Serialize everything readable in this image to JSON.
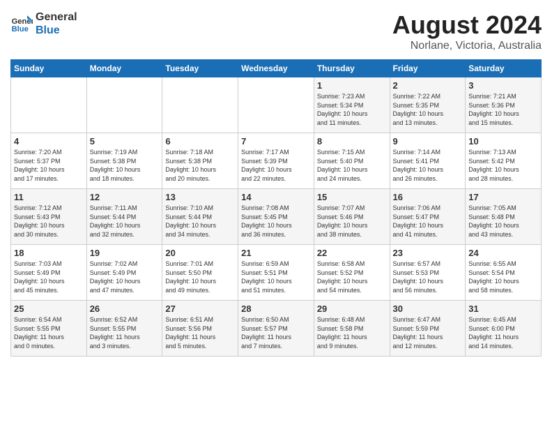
{
  "logo": {
    "line1": "General",
    "line2": "Blue"
  },
  "title": "August 2024",
  "subtitle": "Norlane, Victoria, Australia",
  "days_of_week": [
    "Sunday",
    "Monday",
    "Tuesday",
    "Wednesday",
    "Thursday",
    "Friday",
    "Saturday"
  ],
  "weeks": [
    [
      {
        "day": "",
        "info": ""
      },
      {
        "day": "",
        "info": ""
      },
      {
        "day": "",
        "info": ""
      },
      {
        "day": "",
        "info": ""
      },
      {
        "day": "1",
        "info": "Sunrise: 7:23 AM\nSunset: 5:34 PM\nDaylight: 10 hours\nand 11 minutes."
      },
      {
        "day": "2",
        "info": "Sunrise: 7:22 AM\nSunset: 5:35 PM\nDaylight: 10 hours\nand 13 minutes."
      },
      {
        "day": "3",
        "info": "Sunrise: 7:21 AM\nSunset: 5:36 PM\nDaylight: 10 hours\nand 15 minutes."
      }
    ],
    [
      {
        "day": "4",
        "info": "Sunrise: 7:20 AM\nSunset: 5:37 PM\nDaylight: 10 hours\nand 17 minutes."
      },
      {
        "day": "5",
        "info": "Sunrise: 7:19 AM\nSunset: 5:38 PM\nDaylight: 10 hours\nand 18 minutes."
      },
      {
        "day": "6",
        "info": "Sunrise: 7:18 AM\nSunset: 5:38 PM\nDaylight: 10 hours\nand 20 minutes."
      },
      {
        "day": "7",
        "info": "Sunrise: 7:17 AM\nSunset: 5:39 PM\nDaylight: 10 hours\nand 22 minutes."
      },
      {
        "day": "8",
        "info": "Sunrise: 7:15 AM\nSunset: 5:40 PM\nDaylight: 10 hours\nand 24 minutes."
      },
      {
        "day": "9",
        "info": "Sunrise: 7:14 AM\nSunset: 5:41 PM\nDaylight: 10 hours\nand 26 minutes."
      },
      {
        "day": "10",
        "info": "Sunrise: 7:13 AM\nSunset: 5:42 PM\nDaylight: 10 hours\nand 28 minutes."
      }
    ],
    [
      {
        "day": "11",
        "info": "Sunrise: 7:12 AM\nSunset: 5:43 PM\nDaylight: 10 hours\nand 30 minutes."
      },
      {
        "day": "12",
        "info": "Sunrise: 7:11 AM\nSunset: 5:44 PM\nDaylight: 10 hours\nand 32 minutes."
      },
      {
        "day": "13",
        "info": "Sunrise: 7:10 AM\nSunset: 5:44 PM\nDaylight: 10 hours\nand 34 minutes."
      },
      {
        "day": "14",
        "info": "Sunrise: 7:08 AM\nSunset: 5:45 PM\nDaylight: 10 hours\nand 36 minutes."
      },
      {
        "day": "15",
        "info": "Sunrise: 7:07 AM\nSunset: 5:46 PM\nDaylight: 10 hours\nand 38 minutes."
      },
      {
        "day": "16",
        "info": "Sunrise: 7:06 AM\nSunset: 5:47 PM\nDaylight: 10 hours\nand 41 minutes."
      },
      {
        "day": "17",
        "info": "Sunrise: 7:05 AM\nSunset: 5:48 PM\nDaylight: 10 hours\nand 43 minutes."
      }
    ],
    [
      {
        "day": "18",
        "info": "Sunrise: 7:03 AM\nSunset: 5:49 PM\nDaylight: 10 hours\nand 45 minutes."
      },
      {
        "day": "19",
        "info": "Sunrise: 7:02 AM\nSunset: 5:49 PM\nDaylight: 10 hours\nand 47 minutes."
      },
      {
        "day": "20",
        "info": "Sunrise: 7:01 AM\nSunset: 5:50 PM\nDaylight: 10 hours\nand 49 minutes."
      },
      {
        "day": "21",
        "info": "Sunrise: 6:59 AM\nSunset: 5:51 PM\nDaylight: 10 hours\nand 51 minutes."
      },
      {
        "day": "22",
        "info": "Sunrise: 6:58 AM\nSunset: 5:52 PM\nDaylight: 10 hours\nand 54 minutes."
      },
      {
        "day": "23",
        "info": "Sunrise: 6:57 AM\nSunset: 5:53 PM\nDaylight: 10 hours\nand 56 minutes."
      },
      {
        "day": "24",
        "info": "Sunrise: 6:55 AM\nSunset: 5:54 PM\nDaylight: 10 hours\nand 58 minutes."
      }
    ],
    [
      {
        "day": "25",
        "info": "Sunrise: 6:54 AM\nSunset: 5:55 PM\nDaylight: 11 hours\nand 0 minutes."
      },
      {
        "day": "26",
        "info": "Sunrise: 6:52 AM\nSunset: 5:55 PM\nDaylight: 11 hours\nand 3 minutes."
      },
      {
        "day": "27",
        "info": "Sunrise: 6:51 AM\nSunset: 5:56 PM\nDaylight: 11 hours\nand 5 minutes."
      },
      {
        "day": "28",
        "info": "Sunrise: 6:50 AM\nSunset: 5:57 PM\nDaylight: 11 hours\nand 7 minutes."
      },
      {
        "day": "29",
        "info": "Sunrise: 6:48 AM\nSunset: 5:58 PM\nDaylight: 11 hours\nand 9 minutes."
      },
      {
        "day": "30",
        "info": "Sunrise: 6:47 AM\nSunset: 5:59 PM\nDaylight: 11 hours\nand 12 minutes."
      },
      {
        "day": "31",
        "info": "Sunrise: 6:45 AM\nSunset: 6:00 PM\nDaylight: 11 hours\nand 14 minutes."
      }
    ]
  ]
}
